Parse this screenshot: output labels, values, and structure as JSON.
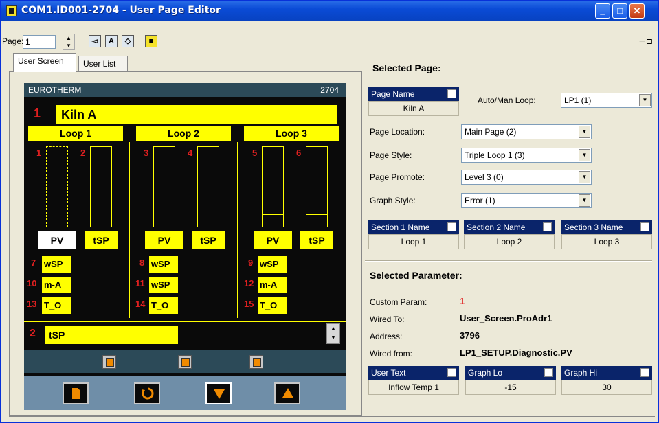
{
  "window": {
    "title": "COM1.ID001-2704 - User Page Editor"
  },
  "toolbar": {
    "page_label": "Page:",
    "page_value": "1"
  },
  "tabs": [
    {
      "label": "User Screen"
    },
    {
      "label": "User List"
    }
  ],
  "device": {
    "brand": "EUROTHERM",
    "model": "2704",
    "kiln_number": "1",
    "kiln_label": "Kiln A",
    "loops": [
      {
        "header": "Loop 1",
        "bar_left_num": "1",
        "bar_right_num": "2",
        "pv": "PV",
        "tsp": "tSP",
        "params": [
          {
            "num": "7",
            "label": "wSP"
          },
          {
            "num": "10",
            "label": "m-A"
          },
          {
            "num": "13",
            "label": "T_O"
          }
        ]
      },
      {
        "header": "Loop 2",
        "bar_left_num": "3",
        "bar_right_num": "4",
        "pv": "PV",
        "tsp": "tSP",
        "params": [
          {
            "num": "8",
            "label": "wSP"
          },
          {
            "num": "11",
            "label": "wSP"
          },
          {
            "num": "14",
            "label": "T_O"
          }
        ]
      },
      {
        "header": "Loop 3",
        "bar_left_num": "5",
        "bar_right_num": "6",
        "pv": "PV",
        "tsp": "tSP",
        "params": [
          {
            "num": "9",
            "label": "wSP"
          },
          {
            "num": "12",
            "label": "m-A"
          },
          {
            "num": "15",
            "label": "T_O"
          }
        ]
      }
    ],
    "bottom_num": "2",
    "bottom_label": "tSP"
  },
  "selected_page": {
    "title": "Selected Page:",
    "page_name_header": "Page Name",
    "page_name_value": "Kiln A",
    "auto_man_label": "Auto/Man Loop:",
    "auto_man_value": "LP1 (1)",
    "fields": [
      {
        "label": "Page Location:",
        "value": "Main Page (2)"
      },
      {
        "label": "Page Style:",
        "value": "Triple Loop 1 (3)"
      },
      {
        "label": "Page Promote:",
        "value": "Level 3 (0)"
      },
      {
        "label": "Graph Style:",
        "value": "Error (1)"
      }
    ],
    "sections": [
      {
        "header": "Section 1 Name",
        "value": "Loop 1"
      },
      {
        "header": "Section 2 Name",
        "value": "Loop 2"
      },
      {
        "header": "Section 3 Name",
        "value": "Loop 3"
      }
    ]
  },
  "selected_parameter": {
    "title": "Selected Parameter:",
    "rows": [
      {
        "label": "Custom Param:",
        "value": "1"
      },
      {
        "label": "Wired To:",
        "value": "User_Screen.ProAdr1"
      },
      {
        "label": "Address:",
        "value": "3796"
      },
      {
        "label": "Wired from:",
        "value": "LP1_SETUP.Diagnostic.PV"
      }
    ],
    "boxes": [
      {
        "header": "User Text",
        "value": "Inflow Temp 1"
      },
      {
        "header": "Graph Lo",
        "value": "-15"
      },
      {
        "header": "Graph Hi",
        "value": "30"
      }
    ]
  },
  "colors": {
    "title_bar": "#0a4bd6",
    "device_bg": "#0a0a0a",
    "device_yellow": "#ffff00",
    "number_red": "#e02020",
    "field_header": "#0a246a"
  }
}
